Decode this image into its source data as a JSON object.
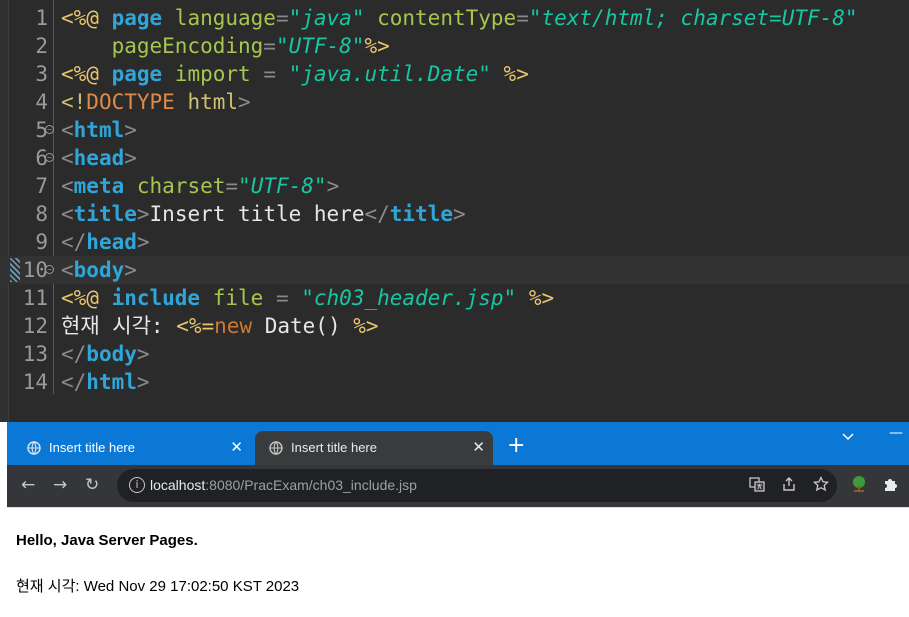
{
  "editor": {
    "lines": [
      {
        "num": "1",
        "fold": false,
        "segments": [
          [
            "tag",
            "<%@ "
          ],
          [
            "kw",
            "page "
          ],
          [
            "attr",
            "language"
          ],
          [
            "punc",
            "="
          ],
          [
            "str",
            "\"java\""
          ],
          [
            "attr",
            " contentType"
          ],
          [
            "punc",
            "="
          ],
          [
            "str",
            "\"text/html; charset=UTF-8\""
          ]
        ]
      },
      {
        "num": "2",
        "fold": false,
        "segments": [
          [
            "attr",
            "    pageEncoding"
          ],
          [
            "punc",
            "="
          ],
          [
            "str",
            "\"UTF-8\""
          ],
          [
            "tag",
            "%>"
          ]
        ]
      },
      {
        "num": "3",
        "fold": false,
        "segments": [
          [
            "tag",
            "<%@ "
          ],
          [
            "kw",
            "page "
          ],
          [
            "attr",
            "import "
          ],
          [
            "punc",
            "= "
          ],
          [
            "str",
            "\"java.util.Date\""
          ],
          [
            "tag",
            " %>"
          ]
        ]
      },
      {
        "num": "4",
        "fold": false,
        "segments": [
          [
            "doctype",
            "<!"
          ],
          [
            "doctype-kw",
            "DOCTYPE "
          ],
          [
            "doctype",
            "html"
          ],
          [
            "punc",
            ">"
          ]
        ]
      },
      {
        "num": "5",
        "fold": true,
        "segments": [
          [
            "punc",
            "<"
          ],
          [
            "kw",
            "html"
          ],
          [
            "punc",
            ">"
          ]
        ]
      },
      {
        "num": "6",
        "fold": true,
        "segments": [
          [
            "punc",
            "<"
          ],
          [
            "kw",
            "head"
          ],
          [
            "punc",
            ">"
          ]
        ]
      },
      {
        "num": "7",
        "fold": false,
        "segments": [
          [
            "punc",
            "<"
          ],
          [
            "kw",
            "meta "
          ],
          [
            "attr",
            "charset"
          ],
          [
            "punc",
            "="
          ],
          [
            "str",
            "\"UTF-8\""
          ],
          [
            "punc",
            ">"
          ]
        ]
      },
      {
        "num": "8",
        "fold": false,
        "segments": [
          [
            "punc",
            "<"
          ],
          [
            "kw",
            "title"
          ],
          [
            "punc",
            ">"
          ],
          [
            "plain",
            "Insert title here"
          ],
          [
            "punc",
            "</"
          ],
          [
            "kw",
            "title"
          ],
          [
            "punc",
            ">"
          ]
        ]
      },
      {
        "num": "9",
        "fold": false,
        "segments": [
          [
            "punc",
            "</"
          ],
          [
            "kw",
            "head"
          ],
          [
            "punc",
            ">"
          ]
        ]
      },
      {
        "num": "10",
        "fold": true,
        "active": true,
        "segments": [
          [
            "punc",
            "<"
          ],
          [
            "kw",
            "body"
          ],
          [
            "punc",
            ">"
          ]
        ]
      },
      {
        "num": "11",
        "fold": false,
        "segments": [
          [
            "tag",
            "<%@ "
          ],
          [
            "kw",
            "include "
          ],
          [
            "attr",
            "file "
          ],
          [
            "punc",
            "= "
          ],
          [
            "str",
            "\"ch03_header.jsp\""
          ],
          [
            "tag",
            " %>"
          ]
        ]
      },
      {
        "num": "12",
        "fold": false,
        "segments": [
          [
            "plain",
            "현재 시각: "
          ],
          [
            "tag",
            "<%="
          ],
          [
            "new",
            "new"
          ],
          [
            "plain",
            " Date() "
          ],
          [
            "tag",
            "%>"
          ]
        ]
      },
      {
        "num": "13",
        "fold": false,
        "segments": [
          [
            "punc",
            "</"
          ],
          [
            "kw",
            "body"
          ],
          [
            "punc",
            ">"
          ]
        ]
      },
      {
        "num": "14",
        "fold": false,
        "segments": [
          [
            "punc",
            "</"
          ],
          [
            "kw",
            "html"
          ],
          [
            "punc",
            ">"
          ]
        ]
      }
    ]
  },
  "browser": {
    "tabs": [
      {
        "title": "Insert title here",
        "active": false
      },
      {
        "title": "Insert title here",
        "active": true
      }
    ],
    "new_tab_label": "+",
    "tab_search_icon": "chevron-down-icon",
    "minimize_label": "—",
    "close_glyph": "✕",
    "nav": {
      "back": "←",
      "forward": "→",
      "reload": "↻"
    },
    "address": {
      "host": "localhost",
      "rest": ":8080/PracExam/ch03_include.jsp"
    },
    "page": {
      "heading": "Hello, Java Server Pages.",
      "time_text": "현재 시각: Wed Nov 29 17:02:50 KST 2023"
    }
  },
  "colors": {
    "editor_bg": "#2b2b2b",
    "tabstrip_bg": "#0b78d6",
    "active_tab_bg": "#3a3b3c",
    "toolbar_bg": "#35363a"
  }
}
